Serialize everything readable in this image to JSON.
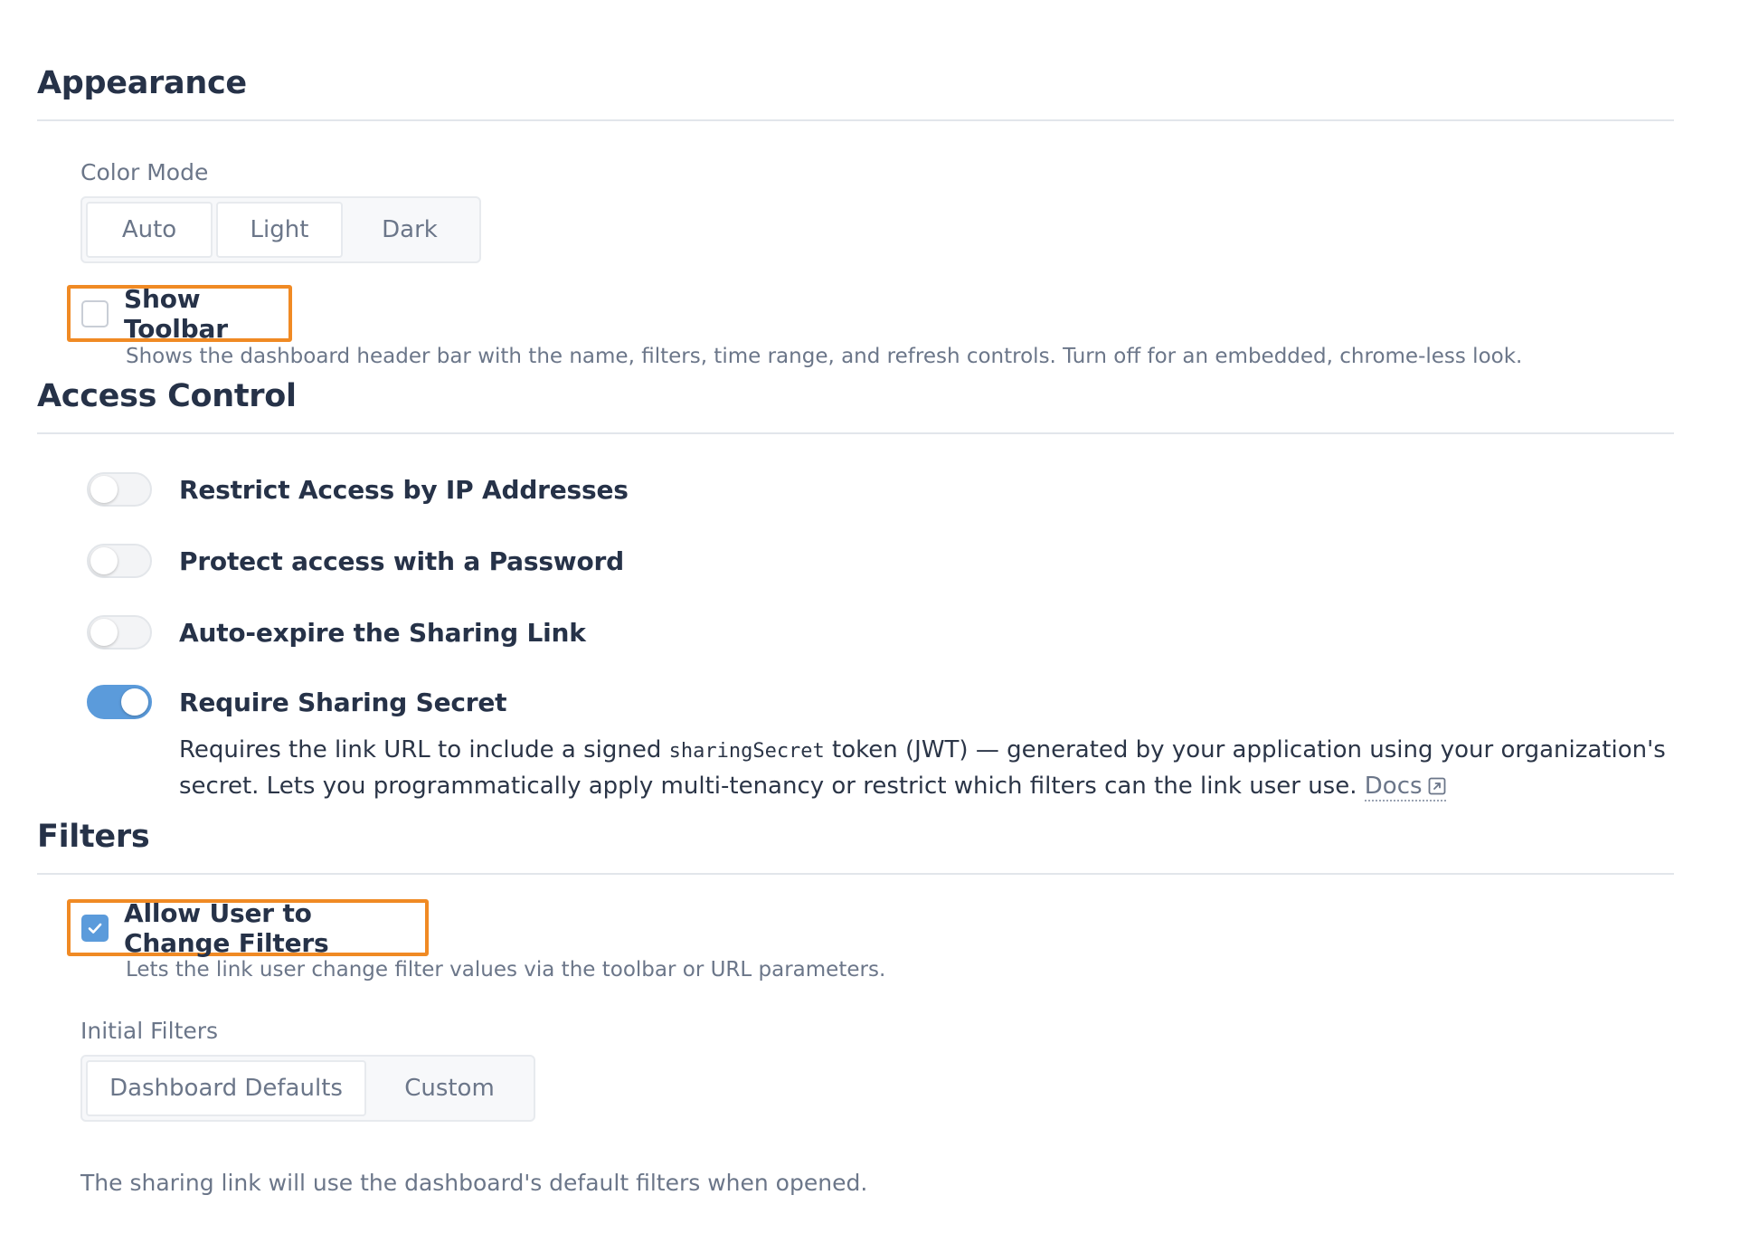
{
  "appearance": {
    "title": "Appearance",
    "color_mode": {
      "label": "Color Mode",
      "options": [
        "Auto",
        "Light",
        "Dark"
      ],
      "selected": "Auto"
    },
    "show_toolbar": {
      "label": "Show Toolbar",
      "checked": false,
      "hint": "Shows the dashboard header bar with the name, filters, time range, and refresh controls. Turn off for an embedded, chrome-less look."
    }
  },
  "access_control": {
    "title": "Access Control",
    "toggles": [
      {
        "label": "Restrict Access by IP Addresses",
        "on": false
      },
      {
        "label": "Protect access with a Password",
        "on": false
      },
      {
        "label": "Auto-expire the Sharing Link",
        "on": false
      },
      {
        "label": "Require Sharing Secret",
        "on": true
      }
    ],
    "secret_description": {
      "before": "Requires the link URL to include a signed ",
      "code": "sharingSecret",
      "after": " token (JWT) — generated by your application using your organization's secret. Lets you programmatically apply multi-tenancy or restrict which filters can the link user use. ",
      "docs_label": "Docs"
    }
  },
  "filters": {
    "title": "Filters",
    "allow_change": {
      "label": "Allow User to Change Filters",
      "checked": true,
      "hint": "Lets the link user change filter values via the toolbar or URL parameters."
    },
    "initial_filters": {
      "label": "Initial Filters",
      "options": [
        "Dashboard Defaults",
        "Custom"
      ],
      "selected": "Dashboard Defaults"
    },
    "note": "The sharing link will use the dashboard's default filters when opened."
  },
  "colors": {
    "accent": "#5b9bdb",
    "highlight": "#f08a24",
    "heading": "#263248",
    "muted": "#6b7689"
  }
}
